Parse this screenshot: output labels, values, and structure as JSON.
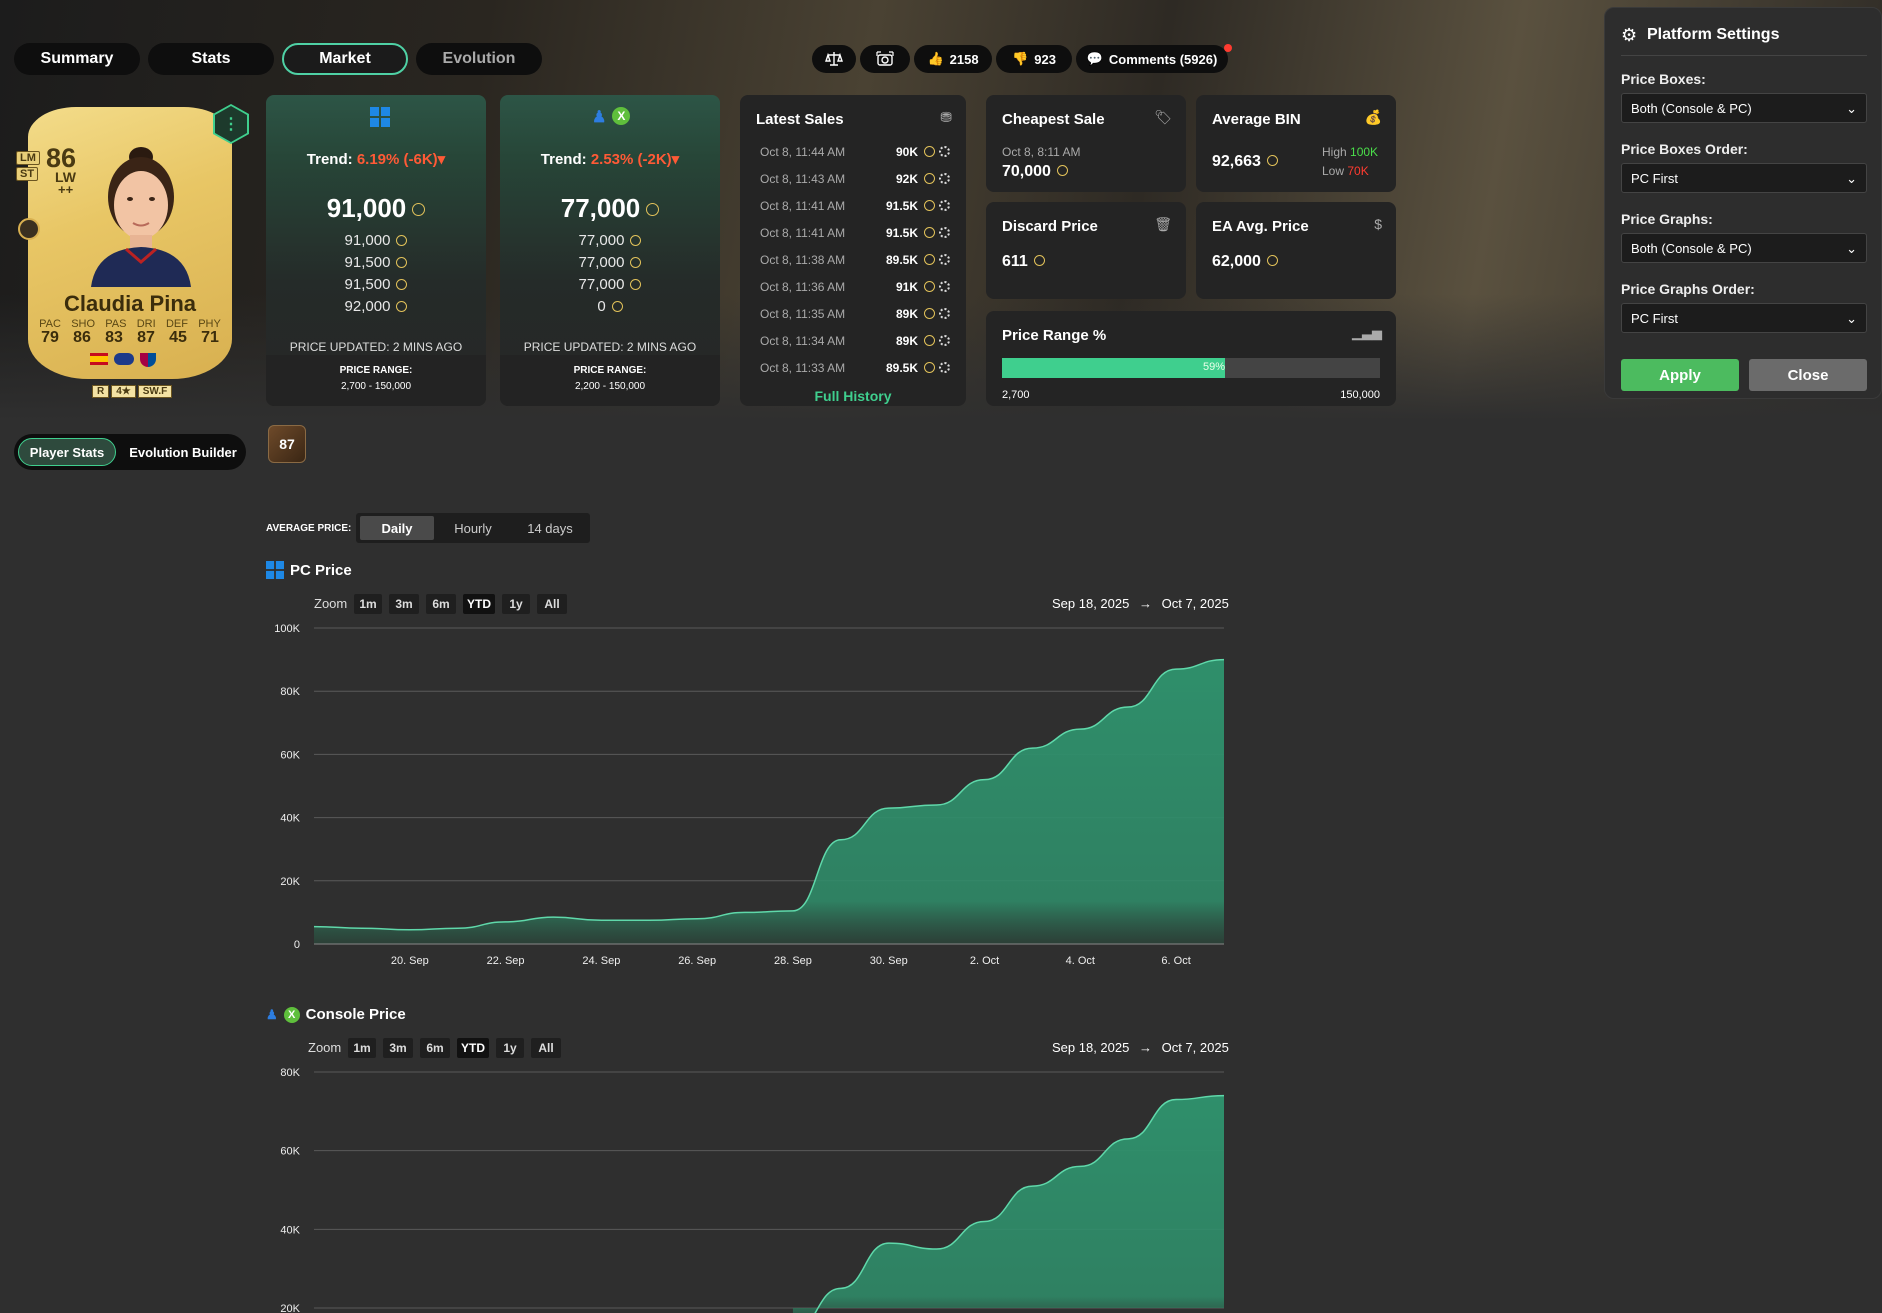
{
  "tabs": [
    {
      "label": "Summary"
    },
    {
      "label": "Stats"
    },
    {
      "label": "Market"
    },
    {
      "label": "Evolution"
    }
  ],
  "actions": {
    "likes": "2158",
    "dislikes": "923",
    "comments": "Comments (5926)"
  },
  "player": {
    "rating": "86",
    "positions": [
      "LM",
      "ST"
    ],
    "main_position": "LW",
    "chem": "++",
    "name": "Claudia Pina",
    "stats": [
      {
        "label": "PAC",
        "value": "79"
      },
      {
        "label": "SHO",
        "value": "86"
      },
      {
        "label": "PAS",
        "value": "83"
      },
      {
        "label": "DRI",
        "value": "87"
      },
      {
        "label": "DEF",
        "value": "45"
      },
      {
        "label": "PHY",
        "value": "71"
      }
    ],
    "foot": "R",
    "skill_moves": "4★",
    "weak_foot": "SW.F",
    "options_icon": "⋮"
  },
  "pc_box": {
    "platform_icon": "windows-icon",
    "trend_label": "Trend:",
    "trend_value": "6.19% (-6K)",
    "price": "91,000",
    "prices": [
      "91,000",
      "91,500",
      "91,500",
      "92,000"
    ],
    "updated": "PRICE UPDATED: 2 MINS AGO",
    "range_label": "PRICE RANGE:",
    "range": "2,700 - 150,000"
  },
  "console_box": {
    "platform_icon": "playstation-xbox-icon",
    "trend_label": "Trend:",
    "trend_value": "2.53% (-2K)",
    "price": "77,000",
    "prices": [
      "77,000",
      "77,000",
      "77,000",
      "0"
    ],
    "updated": "PRICE UPDATED: 2 MINS AGO",
    "range_label": "PRICE RANGE:",
    "range": "2,200 - 150,000"
  },
  "latest_sales": {
    "title": "Latest Sales",
    "rows": [
      {
        "time": "Oct 8, 11:44 AM",
        "price": "90K"
      },
      {
        "time": "Oct 8, 11:43 AM",
        "price": "92K"
      },
      {
        "time": "Oct 8, 11:41 AM",
        "price": "91.5K"
      },
      {
        "time": "Oct 8, 11:41 AM",
        "price": "91.5K"
      },
      {
        "time": "Oct 8, 11:38 AM",
        "price": "89.5K"
      },
      {
        "time": "Oct 8, 11:36 AM",
        "price": "91K"
      },
      {
        "time": "Oct 8, 11:35 AM",
        "price": "89K"
      },
      {
        "time": "Oct 8, 11:34 AM",
        "price": "89K"
      },
      {
        "time": "Oct 8, 11:33 AM",
        "price": "89.5K"
      }
    ],
    "full_history": "Full History"
  },
  "cheapest_sale": {
    "title": "Cheapest Sale",
    "date": "Oct 8, 8:11 AM",
    "value": "70,000"
  },
  "average_bin": {
    "title": "Average BIN",
    "value": "92,663",
    "high_label": "High",
    "high": "100K",
    "low_label": "Low",
    "low": "70K"
  },
  "discard_price": {
    "title": "Discard Price",
    "value": "611"
  },
  "ea_avg_price": {
    "title": "EA Avg. Price",
    "value": "62,000"
  },
  "price_range": {
    "title": "Price Range %",
    "percent_label": "59%",
    "fill_fraction": 0.59,
    "min": "2,700",
    "max": "150,000"
  },
  "settings": {
    "title": "Platform Settings",
    "fields": [
      {
        "label": "Price Boxes:",
        "value": "Both (Console & PC)"
      },
      {
        "label": "Price Boxes Order:",
        "value": "PC First"
      },
      {
        "label": "Price Graphs:",
        "value": "Both (Console & PC)"
      },
      {
        "label": "Price Graphs Order:",
        "value": "PC First"
      }
    ],
    "apply": "Apply",
    "close": "Close"
  },
  "lower": {
    "player_stats": "Player Stats",
    "evolution_builder": "Evolution Builder",
    "evo_badge": "87",
    "average_price_label": "AVERAGE PRICE:",
    "periods": [
      "Daily",
      "Hourly",
      "14 days"
    ],
    "active_period": "Daily"
  },
  "zoom": {
    "label": "Zoom",
    "buttons": [
      "1m",
      "3m",
      "6m",
      "YTD",
      "1y",
      "All"
    ],
    "active": "YTD"
  },
  "colors": {
    "accent": "#3fcf8e",
    "area": "#2f8f6b",
    "negative": "#ff5a36"
  },
  "chart_data": [
    {
      "type": "area",
      "title": "PC Price",
      "date_from": "Sep 18, 2025",
      "date_to": "Oct 7, 2025",
      "arrow": "→",
      "y_ticks": [
        "0",
        "20K",
        "40K",
        "60K",
        "80K",
        "100K"
      ],
      "ylim": [
        0,
        100000
      ],
      "x_ticks": [
        "20. Sep",
        "22. Sep",
        "24. Sep",
        "26. Sep",
        "28. Sep",
        "30. Sep",
        "2. Oct",
        "4. Oct",
        "6. Oct"
      ],
      "x": [
        "2025-09-18",
        "2025-09-19",
        "2025-09-20",
        "2025-09-21",
        "2025-09-22",
        "2025-09-23",
        "2025-09-24",
        "2025-09-25",
        "2025-09-26",
        "2025-09-27",
        "2025-09-28",
        "2025-09-29",
        "2025-09-30",
        "2025-10-01",
        "2025-10-02",
        "2025-10-03",
        "2025-10-04",
        "2025-10-05",
        "2025-10-06",
        "2025-10-07"
      ],
      "values": [
        5500,
        5000,
        4500,
        5000,
        7000,
        8500,
        7500,
        7500,
        8000,
        10000,
        10500,
        33000,
        43000,
        44000,
        52000,
        62000,
        68000,
        75000,
        87000,
        90000
      ]
    },
    {
      "type": "area",
      "title": "Console Price",
      "date_from": "Sep 18, 2025",
      "date_to": "Oct 7, 2025",
      "arrow": "→",
      "y_ticks": [
        "20K",
        "40K",
        "60K",
        "80K"
      ],
      "ylim": [
        20000,
        80000
      ],
      "x": [
        "2025-09-28",
        "2025-09-29",
        "2025-09-30",
        "2025-10-01",
        "2025-10-02",
        "2025-10-03",
        "2025-10-04",
        "2025-10-05",
        "2025-10-06",
        "2025-10-07"
      ],
      "values": [
        14000,
        25000,
        36500,
        35000,
        42000,
        51000,
        56000,
        63000,
        73000,
        74000
      ]
    }
  ]
}
